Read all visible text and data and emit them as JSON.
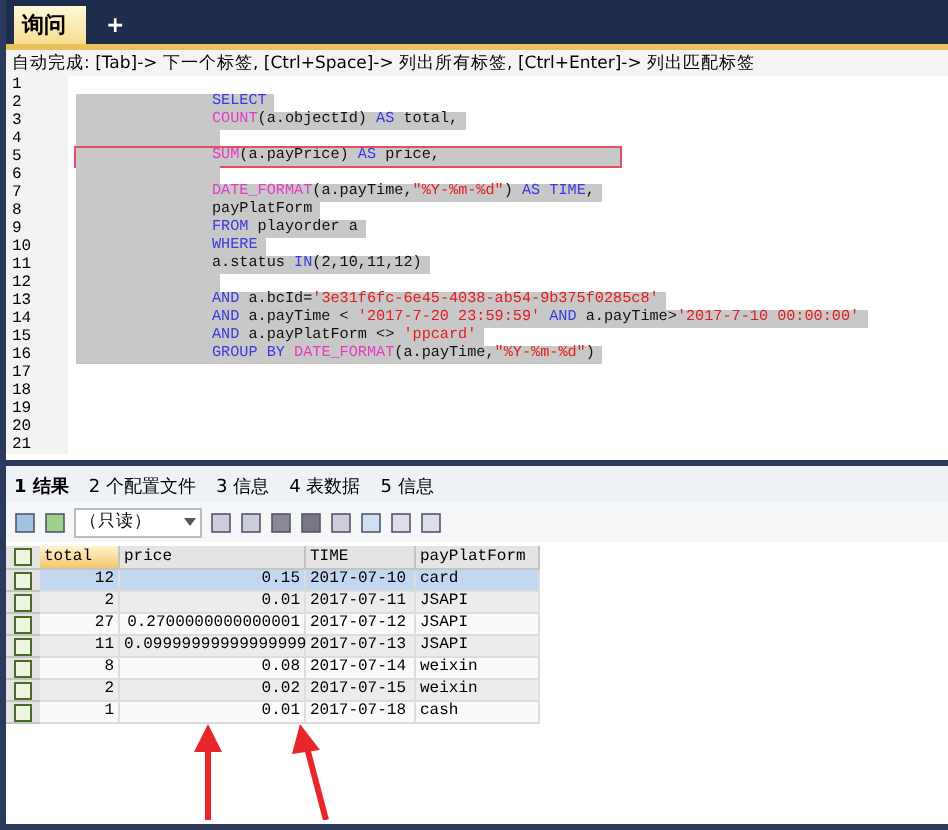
{
  "query_tabs": [
    {
      "label": "询问",
      "selected": true
    },
    {
      "label": "+",
      "selected": false
    }
  ],
  "autocomplete_hint": "自动完成: [Tab]-> 下一个标签, [Ctrl+Space]-> 列出所有标签, [Ctrl+Enter]-> 列出匹配标签",
  "editor": {
    "lines": [
      {
        "number": "1",
        "selected": false,
        "boxed": false
      },
      {
        "number": "2",
        "selected": true,
        "boxed": false,
        "tokens": [
          {
            "kind": "keyword",
            "text": "SELECT"
          }
        ]
      },
      {
        "number": "3",
        "selected": true,
        "boxed": false,
        "tokens": [
          {
            "kind": "function",
            "text": "COUNT"
          },
          {
            "kind": "plain",
            "text": "(a.objectId) "
          },
          {
            "kind": "keyword",
            "text": "AS"
          },
          {
            "kind": "plain",
            "text": " total,"
          }
        ]
      },
      {
        "number": "4",
        "selected": true,
        "boxed": false
      },
      {
        "number": "5",
        "selected": true,
        "boxed": true,
        "tokens": [
          {
            "kind": "function",
            "text": "SUM"
          },
          {
            "kind": "plain",
            "text": "(a.payPrice) "
          },
          {
            "kind": "keyword",
            "text": "AS"
          },
          {
            "kind": "plain",
            "text": " price,"
          }
        ]
      },
      {
        "number": "6",
        "selected": true,
        "boxed": false
      },
      {
        "number": "7",
        "selected": true,
        "boxed": false,
        "tokens": [
          {
            "kind": "function",
            "text": "DATE_FORMAT"
          },
          {
            "kind": "plain",
            "text": "(a.payTime,"
          },
          {
            "kind": "string",
            "text": "\"%Y-%m-%d\""
          },
          {
            "kind": "plain",
            "text": ") "
          },
          {
            "kind": "keyword",
            "text": "AS TIME"
          },
          {
            "kind": "plain",
            "text": ","
          }
        ]
      },
      {
        "number": "8",
        "selected": true,
        "boxed": false,
        "tokens": [
          {
            "kind": "plain",
            "text": "payPlatForm"
          }
        ]
      },
      {
        "number": "9",
        "selected": true,
        "boxed": false,
        "tokens": [
          {
            "kind": "keyword",
            "text": "FROM"
          },
          {
            "kind": "plain",
            "text": " playorder a"
          }
        ]
      },
      {
        "number": "10",
        "selected": true,
        "boxed": false,
        "tokens": [
          {
            "kind": "keyword",
            "text": "WHERE"
          }
        ]
      },
      {
        "number": "11",
        "selected": true,
        "boxed": false,
        "tokens": [
          {
            "kind": "plain",
            "text": "a.status "
          },
          {
            "kind": "keyword",
            "text": "IN"
          },
          {
            "kind": "plain",
            "text": "(2,10,11,12)"
          }
        ]
      },
      {
        "number": "12",
        "selected": true,
        "boxed": false
      },
      {
        "number": "13",
        "selected": true,
        "boxed": false,
        "tokens": [
          {
            "kind": "keyword",
            "text": "AND"
          },
          {
            "kind": "plain",
            "text": " a.bcId="
          },
          {
            "kind": "string",
            "text": "'3e31f6fc-6e45-4038-ab54-9b375f0285c8'"
          }
        ]
      },
      {
        "number": "14",
        "selected": true,
        "boxed": false,
        "tokens": [
          {
            "kind": "keyword",
            "text": "AND"
          },
          {
            "kind": "plain",
            "text": " a.payTime < "
          },
          {
            "kind": "string",
            "text": "'2017-7-20 23:59:59'"
          },
          {
            "kind": "keyword",
            "text": " AND"
          },
          {
            "kind": "plain",
            "text": " a.payTime>"
          },
          {
            "kind": "string",
            "text": "'2017-7-10 00:00:00'"
          }
        ]
      },
      {
        "number": "15",
        "selected": true,
        "boxed": false,
        "tokens": [
          {
            "kind": "keyword",
            "text": "AND"
          },
          {
            "kind": "plain",
            "text": " a.payPlatForm <> "
          },
          {
            "kind": "string",
            "text": "'ppcard'"
          }
        ]
      },
      {
        "number": "16",
        "selected": true,
        "boxed": false,
        "tokens": [
          {
            "kind": "keyword",
            "text": "GROUP BY"
          },
          {
            "kind": "function",
            "text": " DATE_FORMAT"
          },
          {
            "kind": "plain",
            "text": "(a.payTime,"
          },
          {
            "kind": "string",
            "text": "\"%Y-%m-%d\""
          },
          {
            "kind": "plain",
            "text": ")"
          }
        ]
      },
      {
        "number": "17",
        "selected": false,
        "boxed": false
      },
      {
        "number": "18",
        "selected": false,
        "boxed": false
      },
      {
        "number": "19",
        "selected": false,
        "boxed": false
      },
      {
        "number": "20",
        "selected": false,
        "boxed": false
      },
      {
        "number": "21",
        "selected": false,
        "boxed": false
      }
    ]
  },
  "result_tabs": [
    {
      "label": "1 结果",
      "selected": true
    },
    {
      "label": "2 个配置文件",
      "selected": false
    },
    {
      "label": "3 信息",
      "selected": false
    },
    {
      "label": "4 表数据",
      "selected": false
    },
    {
      "label": "5 信息",
      "selected": false
    }
  ],
  "toolbar": {
    "mode_select": "（只读）"
  },
  "table": {
    "header_checked": false,
    "columns": [
      "total",
      "price",
      "TIME",
      "payPlatForm"
    ],
    "rows": [
      {
        "selected": true,
        "checked": false,
        "cells": [
          "12",
          "0.15",
          "2017-07-10",
          "card"
        ]
      },
      {
        "selected": false,
        "checked": false,
        "cells": [
          "2",
          "0.01",
          "2017-07-11",
          "JSAPI"
        ]
      },
      {
        "selected": false,
        "checked": false,
        "cells": [
          "27",
          "0.2700000000000001",
          "2017-07-12",
          "JSAPI"
        ]
      },
      {
        "selected": false,
        "checked": false,
        "cells": [
          "11",
          "0.09999999999999999",
          "2017-07-13",
          "JSAPI"
        ]
      },
      {
        "selected": false,
        "checked": false,
        "cells": [
          "8",
          "0.08",
          "2017-07-14",
          "weixin"
        ]
      },
      {
        "selected": false,
        "checked": false,
        "cells": [
          "2",
          "0.02",
          "2017-07-15",
          "weixin"
        ]
      },
      {
        "selected": false,
        "checked": false,
        "cells": [
          "1",
          "0.01",
          "2017-07-18",
          "cash"
        ]
      }
    ]
  }
}
